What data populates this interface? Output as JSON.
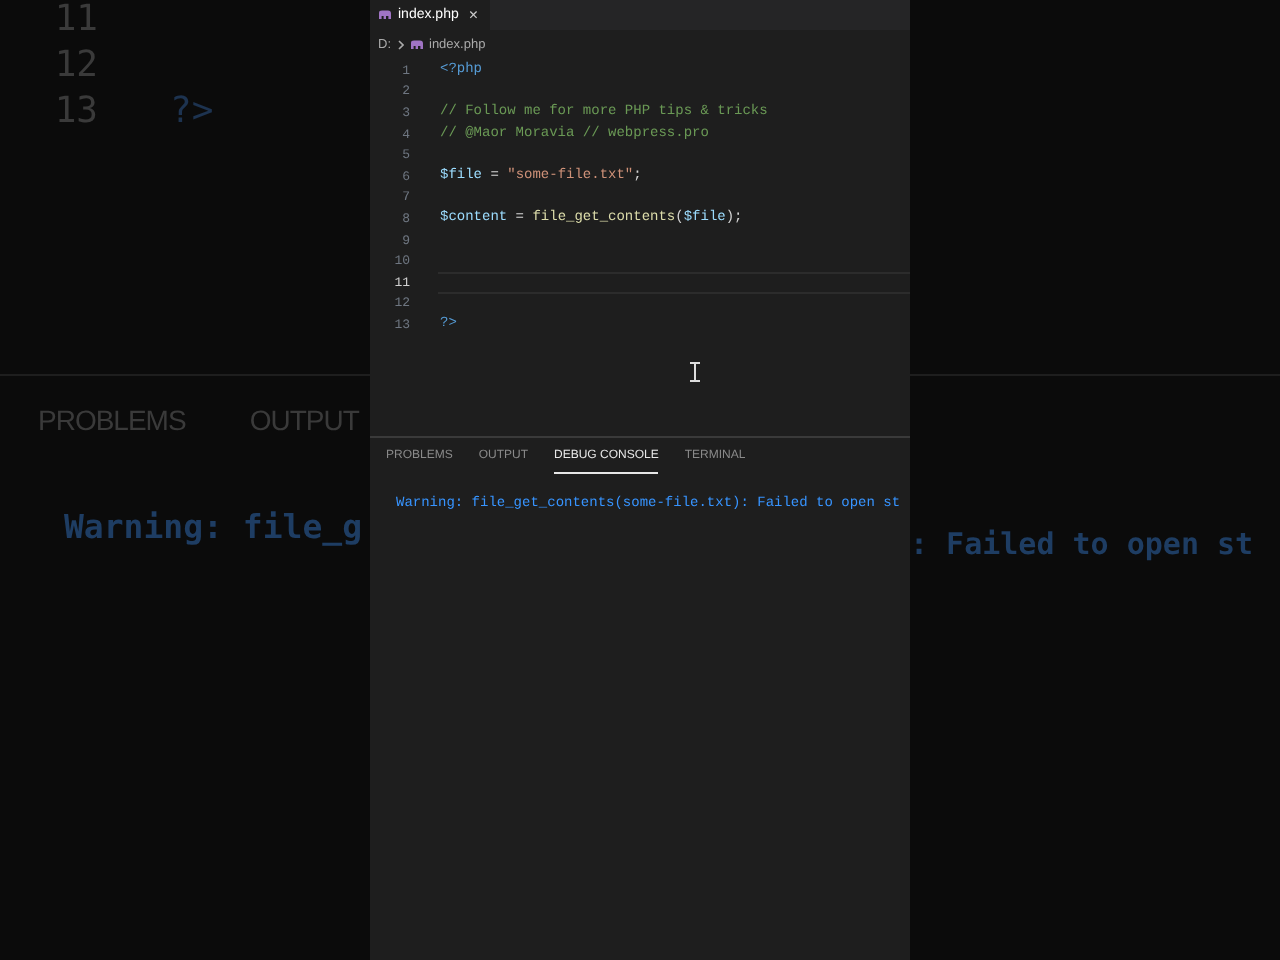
{
  "background": {
    "line_numbers": [
      "11",
      "12",
      "13"
    ],
    "code_line": "?>",
    "panel_tabs": [
      "PROBLEMS",
      "OUTPUT"
    ],
    "console_left": "Warning: file_g",
    "console_right": ": Failed to open st"
  },
  "editor": {
    "tabs": [
      {
        "label": "index.php",
        "close": "×",
        "selected": true
      }
    ],
    "breadcrumb": [
      "D:",
      "index.php"
    ],
    "lines": [
      {
        "number": "1",
        "current": false,
        "tokens": [
          {
            "kind": "tag",
            "text": "<?php"
          }
        ]
      },
      {
        "number": "2",
        "current": false
      },
      {
        "number": "3",
        "current": false,
        "tokens": [
          {
            "kind": "comment",
            "text": "// Follow me for more PHP tips & tricks"
          }
        ]
      },
      {
        "number": "4",
        "current": false,
        "tokens": [
          {
            "kind": "comment",
            "text": "// @Maor Moravia // webpress.pro"
          }
        ]
      },
      {
        "number": "5",
        "current": false
      },
      {
        "number": "6",
        "current": false,
        "tokens": [
          {
            "kind": "variable",
            "text": "$file"
          },
          {
            "kind": "operator",
            "text": " = "
          },
          {
            "kind": "string",
            "text": "\"some-file.txt\""
          },
          {
            "kind": "operator",
            "text": ";"
          }
        ]
      },
      {
        "number": "7",
        "current": false
      },
      {
        "number": "8",
        "current": false,
        "tokens": [
          {
            "kind": "variable",
            "text": "$content"
          },
          {
            "kind": "operator",
            "text": " = "
          },
          {
            "kind": "function",
            "text": "file_get_contents"
          },
          {
            "kind": "operator",
            "text": "("
          },
          {
            "kind": "variable",
            "text": "$file"
          },
          {
            "kind": "operator",
            "text": ");"
          }
        ]
      },
      {
        "number": "9",
        "current": false
      },
      {
        "number": "10",
        "current": false
      },
      {
        "number": "11",
        "current": true
      },
      {
        "number": "12",
        "current": false
      },
      {
        "number": "13",
        "current": false,
        "tokens": [
          {
            "kind": "tag",
            "text": "?>"
          }
        ]
      }
    ]
  },
  "panel": {
    "tabs": [
      {
        "label": "PROBLEMS",
        "selected": false
      },
      {
        "label": "OUTPUT",
        "selected": false
      },
      {
        "label": "DEBUG CONSOLE",
        "selected": true
      },
      {
        "label": "TERMINAL",
        "selected": false
      }
    ],
    "console": [
      {
        "kind": "warning",
        "text": "Warning: file_get_contents(some-file.txt): Failed to open st"
      }
    ]
  }
}
